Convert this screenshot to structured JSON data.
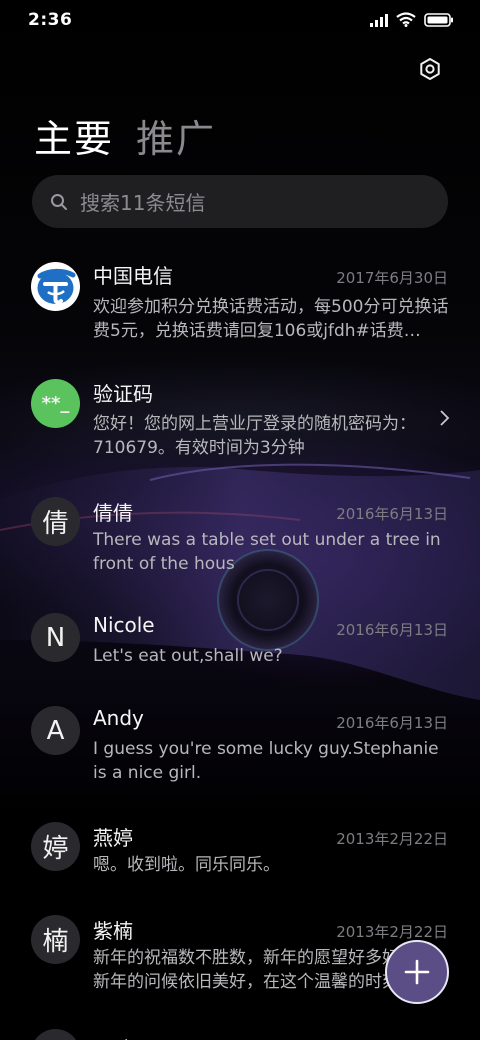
{
  "status_bar": {
    "time": "2:36",
    "icons": [
      "signal-icon",
      "wifi-icon",
      "battery-icon"
    ]
  },
  "header": {
    "settings_icon": "gear-icon",
    "tabs": [
      {
        "label": "主要",
        "active": true
      },
      {
        "label": "推广",
        "active": false
      }
    ]
  },
  "search": {
    "icon": "search-icon",
    "placeholder": "搜索11条短信"
  },
  "messages": [
    {
      "avatar": "china-telecom-logo",
      "name": "中国电信",
      "date": "2017年6月30日",
      "preview": "欢迎参加积分兑换话费活动，每500分可兑换话费5元，兑换话费请回复106或jfdh#话费…"
    },
    {
      "avatar_text": "**_",
      "avatar_color": "#5ac35e",
      "name": "验证码",
      "date": "",
      "preview": "您好！您的网上营业厅登录的随机密码为：710679。有效时间为3分钟",
      "has_chevron": true
    },
    {
      "avatar_text": "倩",
      "name": "倩倩",
      "date": "2016年6月13日",
      "preview": "There was a table set out under a tree in front of the hous"
    },
    {
      "avatar_text": "N",
      "name": "Nicole",
      "date": "2016年6月13日",
      "preview": "Let's eat out,shall we?"
    },
    {
      "avatar_text": "A",
      "name": "Andy",
      "date": "2016年6月13日",
      "preview": "I guess you're some lucky guy.Stephanie is a nice girl."
    },
    {
      "avatar_text": "婷",
      "name": "燕婷",
      "date": "2013年2月22日",
      "preview": "嗯。收到啦。同乐同乐。"
    },
    {
      "avatar_text": "楠",
      "name": "紫楠",
      "date": "2013年2月22日",
      "preview": "新年的祝福数不胜数，新年的愿望好多好多，新年的问候依旧美好，在这个温馨的时刻"
    },
    {
      "avatar_text": "",
      "name": "子玲",
      "date": "",
      "preview": ""
    }
  ],
  "fab": {
    "icon": "plus-icon"
  },
  "colors": {
    "background": "#000000",
    "search_bg": "#1f1f22",
    "fab_bg": "#5b4e86",
    "verify_avatar": "#5ac35e"
  }
}
